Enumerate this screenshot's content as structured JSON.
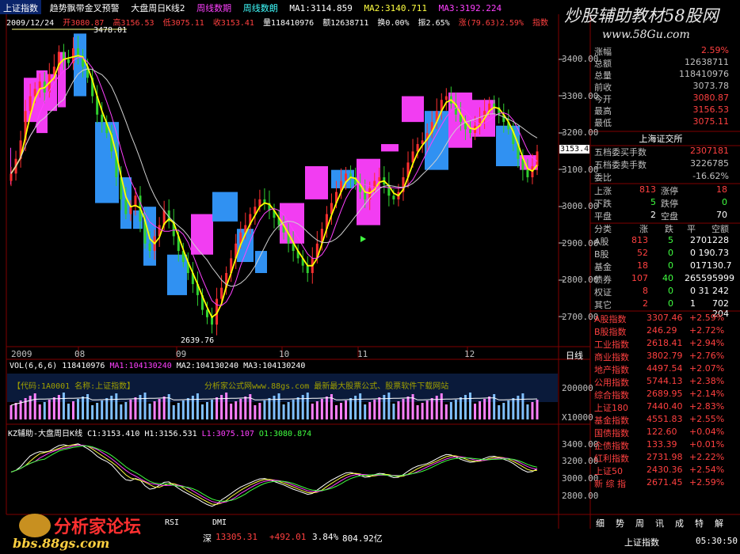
{
  "header": {
    "index_name": "上证指数",
    "indicator_name": "趋势飘带金叉预警",
    "chart_title": "大盘周日K线2",
    "tab_line": "周线数期",
    "tab_week": "周线数朗",
    "ma1": "MA1:3114.859",
    "ma2": "MA2:3140.711",
    "ma3": "MA3:3192.224"
  },
  "info_bar": {
    "date": "2009/12/24",
    "open": "开3080.87",
    "high": "高3156.53",
    "low": "低3075.11",
    "close": "收3153.41",
    "volume": "量118410976",
    "amount": "额12638711",
    "turnover": "换0.00%",
    "amplitude": "振2.65%",
    "change": "涨(79.63)2.59%",
    "index_label": "指数"
  },
  "watermark": {
    "text": "炒股辅助教材58股网",
    "url": "www.58Gu.com"
  },
  "price_axis": {
    "labels": [
      "3400.00",
      "3300.00",
      "3200.00",
      "3100.00",
      "3000.00",
      "2900.00",
      "2800.00",
      "2700.00"
    ],
    "current": "3153.4",
    "high_mark": "3478.01",
    "low_mark": "2639.76"
  },
  "date_axis": {
    "labels": [
      "2009",
      "08",
      "09",
      "10",
      "11",
      "12"
    ],
    "cycle": "日线"
  },
  "volume_panel": {
    "header_vol": "VOL(6,6,6)",
    "header_val": "118410976",
    "ma1": "MA1:104130240",
    "ma2": "MA2:104130240",
    "ma3": "MA3:104130240",
    "code_text": "【代码:1A0001 名称:上证指数】",
    "promo_text": "分析家公式网www.88gs.com 最新最大股票公式、股票软件下载网站",
    "axis_top": "200000",
    "axis_bottom": "X10000"
  },
  "kd_panel": {
    "header": "KZ辅助-大盘周日K线",
    "c1": "C1:3153.410",
    "h1": "H1:3156.531",
    "l1": "L1:3075.107",
    "o1": "O1:3080.874",
    "axis": [
      "3400.00",
      "3200.00",
      "3000.00",
      "2800.00"
    ]
  },
  "quote": {
    "rows": [
      {
        "label": "涨幅",
        "value": "2.59%",
        "color": "#ff4040"
      },
      {
        "label": "总额",
        "value": "12638711",
        "color": "#c0c0c0"
      },
      {
        "label": "总量",
        "value": "118410976",
        "color": "#c0c0c0"
      },
      {
        "label": "前收",
        "value": "3073.78",
        "color": "#c0c0c0"
      },
      {
        "label": "今开",
        "value": "3080.87",
        "color": "#ff4040"
      },
      {
        "label": "最高",
        "value": "3156.53",
        "color": "#ff4040"
      },
      {
        "label": "最低",
        "value": "3075.11",
        "color": "#ff4040"
      }
    ],
    "exchange": "上海证交所",
    "buy_label": "五档委买手数",
    "buy_value": "2307181",
    "sell_label": "五档委卖手数",
    "sell_value": "3226785",
    "ratio_label": "委比",
    "ratio_value": "-16.62%",
    "updown": [
      {
        "l1": "上涨",
        "v1": "813",
        "l2": "涨停",
        "v2": "18"
      },
      {
        "l1": "下跌",
        "v1": "5",
        "l2": "跌停",
        "v2": "0"
      },
      {
        "l1": "平盘",
        "v1": "2",
        "l2": "空盘",
        "v2": "70"
      }
    ],
    "class_head": [
      "分类",
      "涨",
      "跌",
      "平",
      "空额"
    ],
    "class_rows": [
      [
        "A股",
        "813",
        "5",
        "2",
        "701228"
      ],
      [
        "B股",
        "52",
        "0",
        "0",
        "190.73"
      ],
      [
        "基金",
        "18",
        "0",
        "0",
        "17130.7"
      ],
      [
        "债券",
        "107",
        "40",
        "26",
        "5595999"
      ],
      [
        "权证",
        "8",
        "0",
        "0",
        "31 242"
      ],
      [
        "其它",
        "2",
        "0",
        "1",
        "702 204"
      ]
    ],
    "indices": [
      [
        "A股指数",
        "3307.46",
        "+2.59%"
      ],
      [
        "B股指数",
        "246.29",
        "+2.72%"
      ],
      [
        "工业指数",
        "2618.41",
        "+2.94%"
      ],
      [
        "商业指数",
        "3802.79",
        "+2.76%"
      ],
      [
        "地产指数",
        "4497.54",
        "+2.07%"
      ],
      [
        "公用指数",
        "5744.13",
        "+2.38%"
      ],
      [
        "综合指数",
        "2689.95",
        "+2.14%"
      ],
      [
        "上证180",
        "7440.40",
        "+2.83%"
      ],
      [
        "基金指数",
        "4551.83",
        "+2.55%"
      ],
      [
        "国债指数",
        "122.60",
        "+0.04%"
      ],
      [
        "企债指数",
        "133.39",
        "+0.01%"
      ],
      [
        "红利指数",
        "2731.98",
        "+2.22%"
      ],
      [
        "上证50",
        "2430.36",
        "+2.54%"
      ],
      [
        "新 综 指",
        "2671.45",
        "+2.59%"
      ]
    ],
    "tabs": [
      "细",
      "势",
      "周",
      "讯",
      "成",
      "特",
      "解"
    ]
  },
  "bottom": {
    "tabs": [
      "RSI",
      "DMI"
    ],
    "market": "深",
    "market_value": "13305.31",
    "market_change": "+492.01",
    "market_pct": "3.84%",
    "market_amount": "804.92亿",
    "stock": "上证指数",
    "time": "05:30:50"
  },
  "logo": {
    "name": "分析家论坛",
    "url": "bbs.88gs.com"
  },
  "colors": {
    "up": "#ff40ff",
    "down": "#3399ff",
    "small_up": "#ff3030",
    "small_down": "#30d030",
    "ma_white": "#ffffff",
    "ma_yellow": "#ffff00",
    "ma_magenta": "#ff40ff",
    "grid": "#800000"
  }
}
